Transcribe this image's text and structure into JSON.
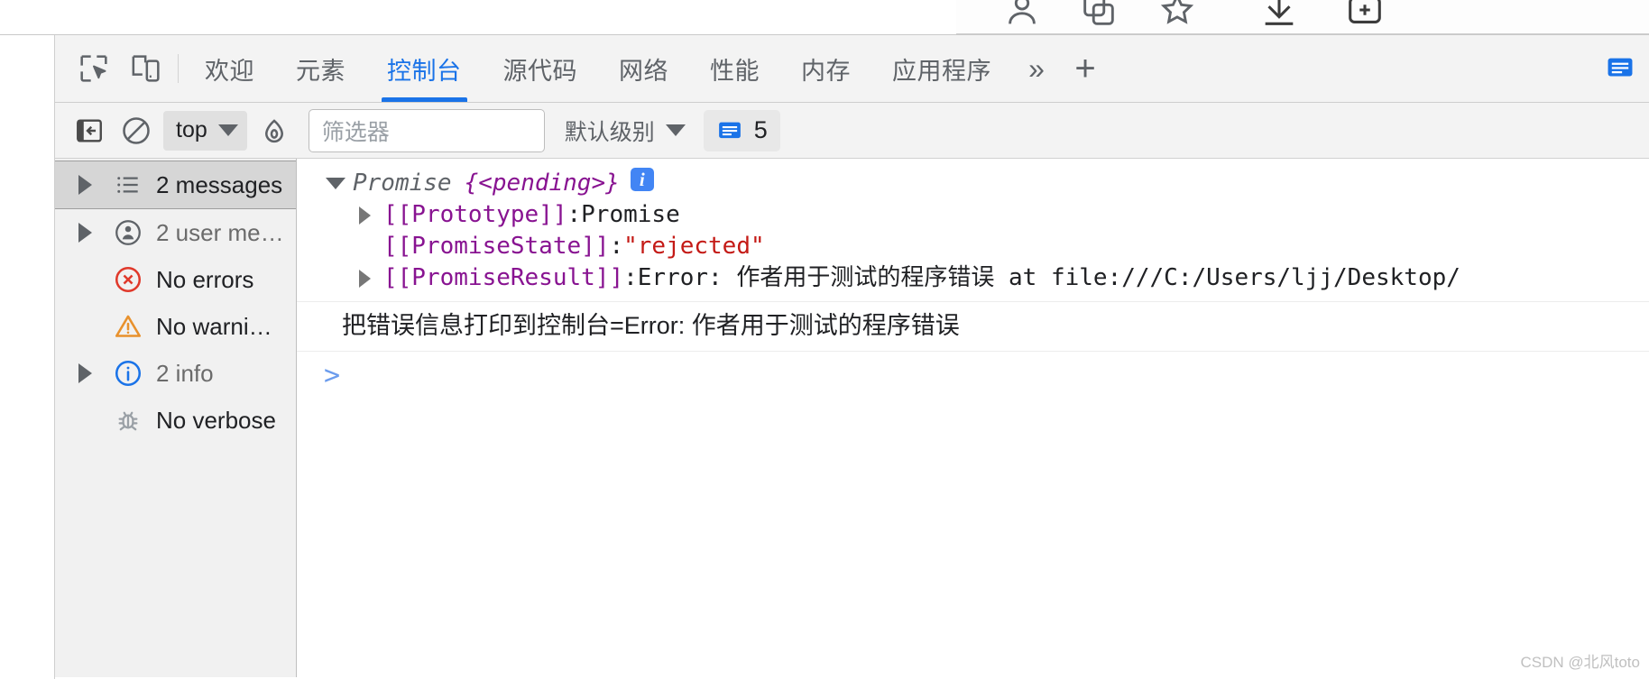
{
  "browser_strip": {
    "icons": [
      "account-icon",
      "extensions-icon",
      "bookmark-star-icon",
      "downloads-icon",
      "add-tab-icon"
    ]
  },
  "devtools": {
    "tabbar": {
      "inspect_icon": "inspect-element-icon",
      "device_icon": "device-toolbar-icon",
      "tabs": [
        {
          "label": "欢迎",
          "name": "tab-welcome",
          "active": false
        },
        {
          "label": "元素",
          "name": "tab-elements",
          "active": false
        },
        {
          "label": "控制台",
          "name": "tab-console",
          "active": true
        },
        {
          "label": "源代码",
          "name": "tab-sources",
          "active": false
        },
        {
          "label": "网络",
          "name": "tab-network",
          "active": false
        },
        {
          "label": "性能",
          "name": "tab-performance",
          "active": false
        },
        {
          "label": "内存",
          "name": "tab-memory",
          "active": false
        },
        {
          "label": "应用程序",
          "name": "tab-application",
          "active": false
        }
      ],
      "more_label": "»",
      "plus_label": "+",
      "right_icon": "console-message-icon"
    },
    "toolbar": {
      "sidebar_toggle_icon": "show-console-sidebar-icon",
      "clear_icon": "clear-console-icon",
      "context_label": "top",
      "eye_icon": "live-expression-icon",
      "filter_placeholder": "筛选器",
      "filter_value": "",
      "level_label": "默认级别",
      "message_icon": "message-icon",
      "message_count": "5"
    },
    "sidebar": {
      "items": [
        {
          "label": "2 messages",
          "icon": "list-icon",
          "expandable": true,
          "selected": true,
          "muted": false
        },
        {
          "label": "2 user me…",
          "icon": "user-message-icon",
          "expandable": true,
          "selected": false,
          "muted": true
        },
        {
          "label": "No errors",
          "icon": "error-icon",
          "expandable": false,
          "selected": false,
          "muted": false
        },
        {
          "label": "No warni…",
          "icon": "warning-icon",
          "expandable": false,
          "selected": false,
          "muted": false
        },
        {
          "label": "2 info",
          "icon": "info-icon",
          "expandable": true,
          "selected": false,
          "muted": true
        },
        {
          "label": "No verbose",
          "icon": "verbose-bug-icon",
          "expandable": false,
          "selected": false,
          "muted": false
        }
      ]
    },
    "console": {
      "promise_line": {
        "object": "Promise",
        "state": "{<pending>}",
        "badge": "i"
      },
      "rows": [
        {
          "key": "[[Prototype]]",
          "sep": ": ",
          "value": "Promise",
          "value_class": "plain",
          "expandable": true
        },
        {
          "key": "[[PromiseState]]",
          "sep": ": ",
          "value": "\"rejected\"",
          "value_class": "str",
          "expandable": false
        },
        {
          "key": "[[PromiseResult]]",
          "sep": ": ",
          "value": "Error: 作者用于测试的程序错误 at file:///C:/Users/ljj/Desktop/",
          "value_class": "err",
          "expandable": true
        }
      ],
      "log_message": "把错误信息打印到控制台=Error: 作者用于测试的程序错误",
      "prompt_caret": ">"
    },
    "watermark": "CSDN @北风toto"
  }
}
